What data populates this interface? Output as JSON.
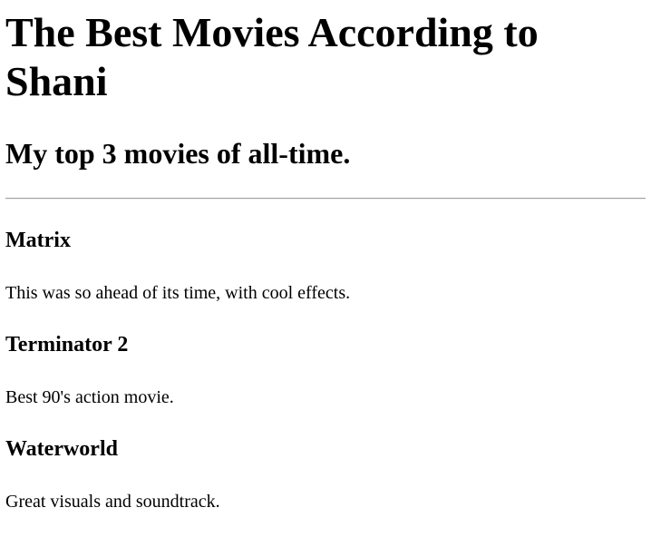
{
  "page": {
    "title": "The Best Movies According to Shani",
    "subtitle": "My top 3 movies of all-time."
  },
  "movies": [
    {
      "title": "Matrix",
      "description": "This was so ahead of its time, with cool effects."
    },
    {
      "title": "Terminator 2",
      "description": "Best 90's action movie."
    },
    {
      "title": "Waterworld",
      "description": "Great visuals and soundtrack."
    }
  ]
}
